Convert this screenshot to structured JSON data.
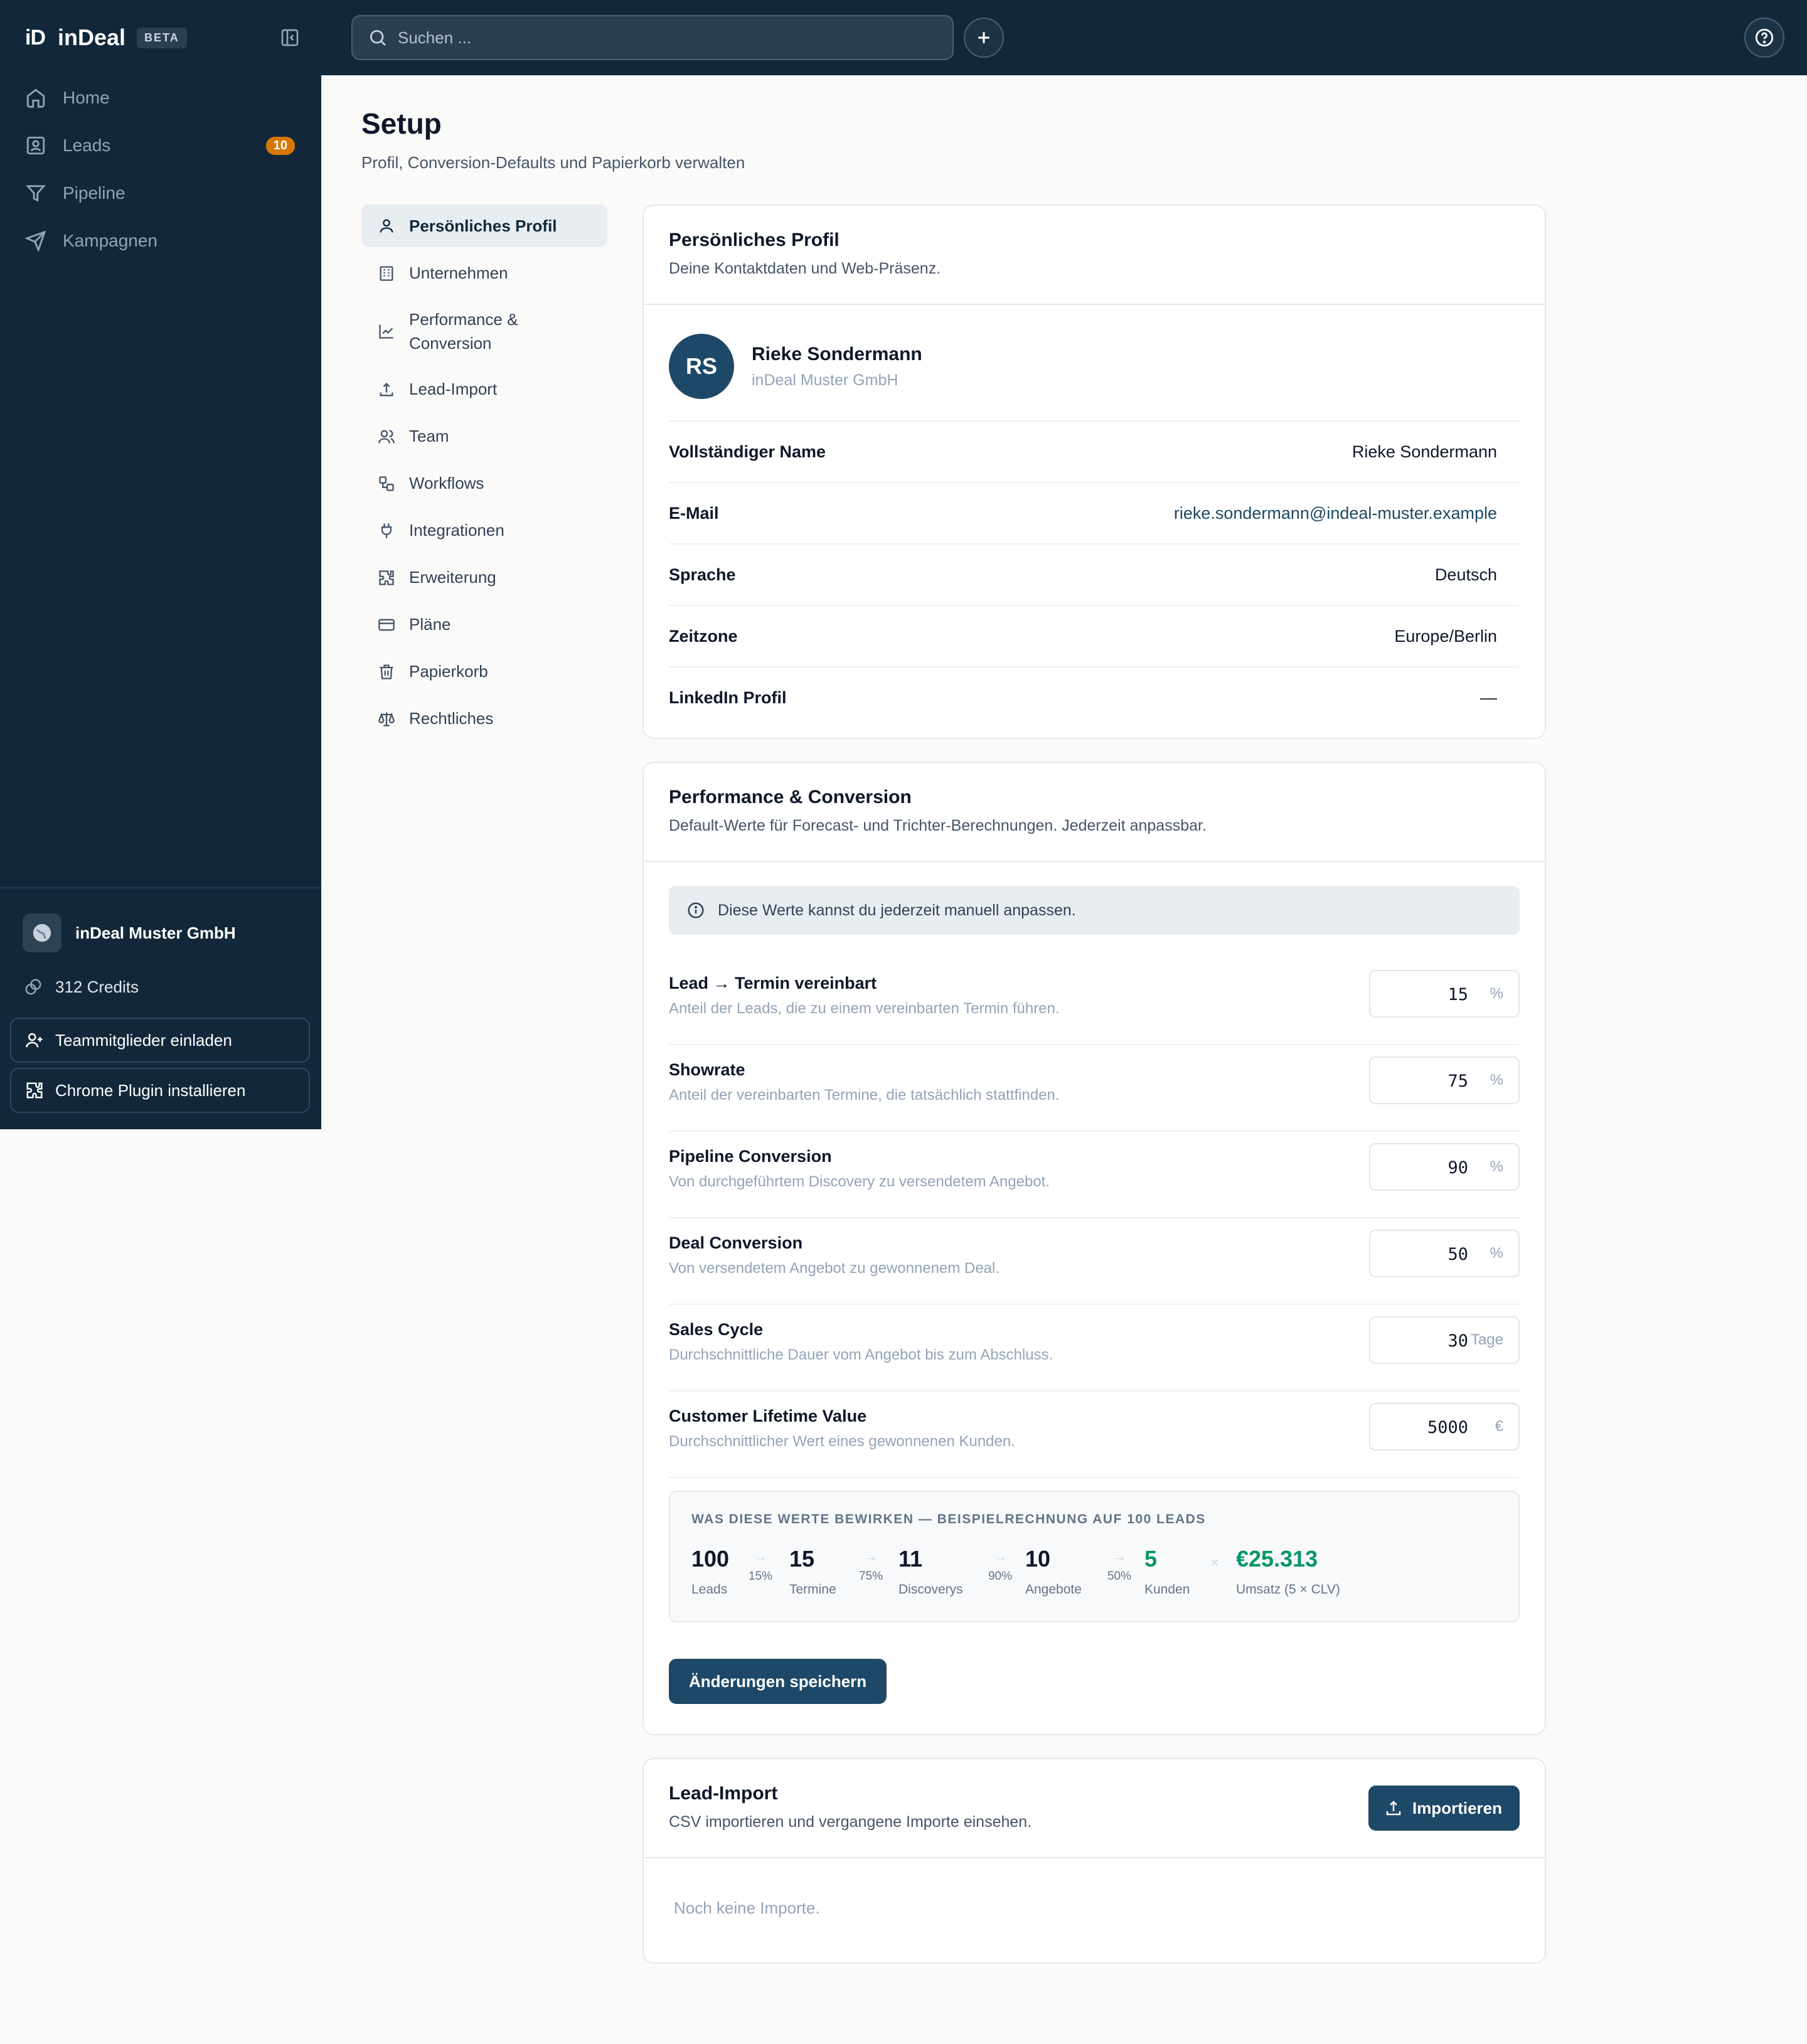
{
  "brand": {
    "mark": "iD",
    "name": "inDeal",
    "badge": "BETA"
  },
  "sidebar": {
    "items": [
      {
        "label": "Home",
        "icon": "home-icon"
      },
      {
        "label": "Leads",
        "icon": "contact-icon",
        "badge": "10"
      },
      {
        "label": "Pipeline",
        "icon": "filter-icon"
      },
      {
        "label": "Kampagnen",
        "icon": "send-icon"
      }
    ],
    "org_name": "inDeal Muster GmbH",
    "credits": "312 Credits",
    "invite_label": "Teammitglieder einladen",
    "plugin_label": "Chrome Plugin installieren"
  },
  "search": {
    "placeholder": "Suchen ..."
  },
  "page": {
    "title": "Setup",
    "subtitle": "Profil, Conversion-Defaults und Papierkorb verwalten"
  },
  "setup_nav": [
    {
      "label": "Persönliches Profil",
      "icon": "user-icon",
      "active": true
    },
    {
      "label": "Unternehmen",
      "icon": "building-icon"
    },
    {
      "label": "Performance & Conversion",
      "icon": "chart-line-icon"
    },
    {
      "label": "Lead-Import",
      "icon": "upload-icon"
    },
    {
      "label": "Team",
      "icon": "users-icon"
    },
    {
      "label": "Workflows",
      "icon": "workflow-icon"
    },
    {
      "label": "Integrationen",
      "icon": "plug-icon"
    },
    {
      "label": "Erweiterung",
      "icon": "puzzle-icon"
    },
    {
      "label": "Pläne",
      "icon": "credit-card-icon"
    },
    {
      "label": "Papierkorb",
      "icon": "trash-icon"
    },
    {
      "label": "Rechtliches",
      "icon": "scale-icon"
    }
  ],
  "profile": {
    "title": "Persönliches Profil",
    "desc": "Deine Kontaktdaten und Web-Präsenz.",
    "initials": "RS",
    "name": "Rieke Sondermann",
    "company": "inDeal Muster GmbH",
    "fields": [
      {
        "label": "Vollständiger Name",
        "value": "Rieke Sondermann"
      },
      {
        "label": "E-Mail",
        "value": "rieke.sondermann@indeal-muster.example"
      },
      {
        "label": "Sprache",
        "value": "Deutsch"
      },
      {
        "label": "Zeitzone",
        "value": "Europe/Berlin"
      },
      {
        "label": "LinkedIn Profil",
        "value": "—"
      }
    ]
  },
  "performance": {
    "title": "Performance & Conversion",
    "desc": "Default-Werte für Forecast- und Trichter-Berechnungen. Jederzeit anpassbar.",
    "info": "Diese Werte kannst du jederzeit manuell anpassen.",
    "metrics": [
      {
        "label": "Lead → Termin vereinbart",
        "desc": "Anteil der Leads, die zu einem vereinbarten Termin führen.",
        "value": "15",
        "unit": "%"
      },
      {
        "label": "Showrate",
        "desc": "Anteil der vereinbarten Termine, die tatsächlich stattfinden.",
        "value": "75",
        "unit": "%"
      },
      {
        "label": "Pipeline Conversion",
        "desc": "Von durchgeführtem Discovery zu versendetem Angebot.",
        "value": "90",
        "unit": "%"
      },
      {
        "label": "Deal Conversion",
        "desc": "Von versendetem Angebot zu gewonnenem Deal.",
        "value": "50",
        "unit": "%"
      },
      {
        "label": "Sales Cycle",
        "desc": "Durchschnittliche Dauer vom Angebot bis zum Abschluss.",
        "value": "30",
        "unit": "Tage"
      },
      {
        "label": "Customer Lifetime Value",
        "desc": "Durchschnittlicher Wert eines gewonnenen Kunden.",
        "value": "5000",
        "unit": "€"
      }
    ],
    "calc": {
      "title": "WAS DIESE WERTE BEWIRKEN — BEISPIELRECHNUNG AUF 100 LEADS",
      "steps": [
        {
          "num": "100",
          "label": "Leads"
        },
        {
          "num": "15",
          "label": "Termine"
        },
        {
          "num": "11",
          "label": "Discoverys"
        },
        {
          "num": "10",
          "label": "Angebote"
        },
        {
          "num": "5",
          "label": "Kunden"
        },
        {
          "num": "€25.313",
          "label": "Umsatz (5 × CLV)"
        }
      ],
      "arrows": [
        {
          "glyph": "→",
          "pct": "15%"
        },
        {
          "glyph": "→",
          "pct": "75%"
        },
        {
          "glyph": "→",
          "pct": "90%"
        },
        {
          "glyph": "→",
          "pct": "50%"
        },
        {
          "glyph": "×",
          "pct": ""
        }
      ]
    },
    "save_label": "Änderungen speichern"
  },
  "lead_import": {
    "title": "Lead-Import",
    "desc": "CSV importieren und vergangene Importe einsehen.",
    "button_label": "Importieren",
    "empty": "Noch keine Importe."
  },
  "colors": {
    "sidebar_bg": "#12283a",
    "accent": "#1e4867",
    "badge": "#d97706",
    "success": "#059669"
  }
}
